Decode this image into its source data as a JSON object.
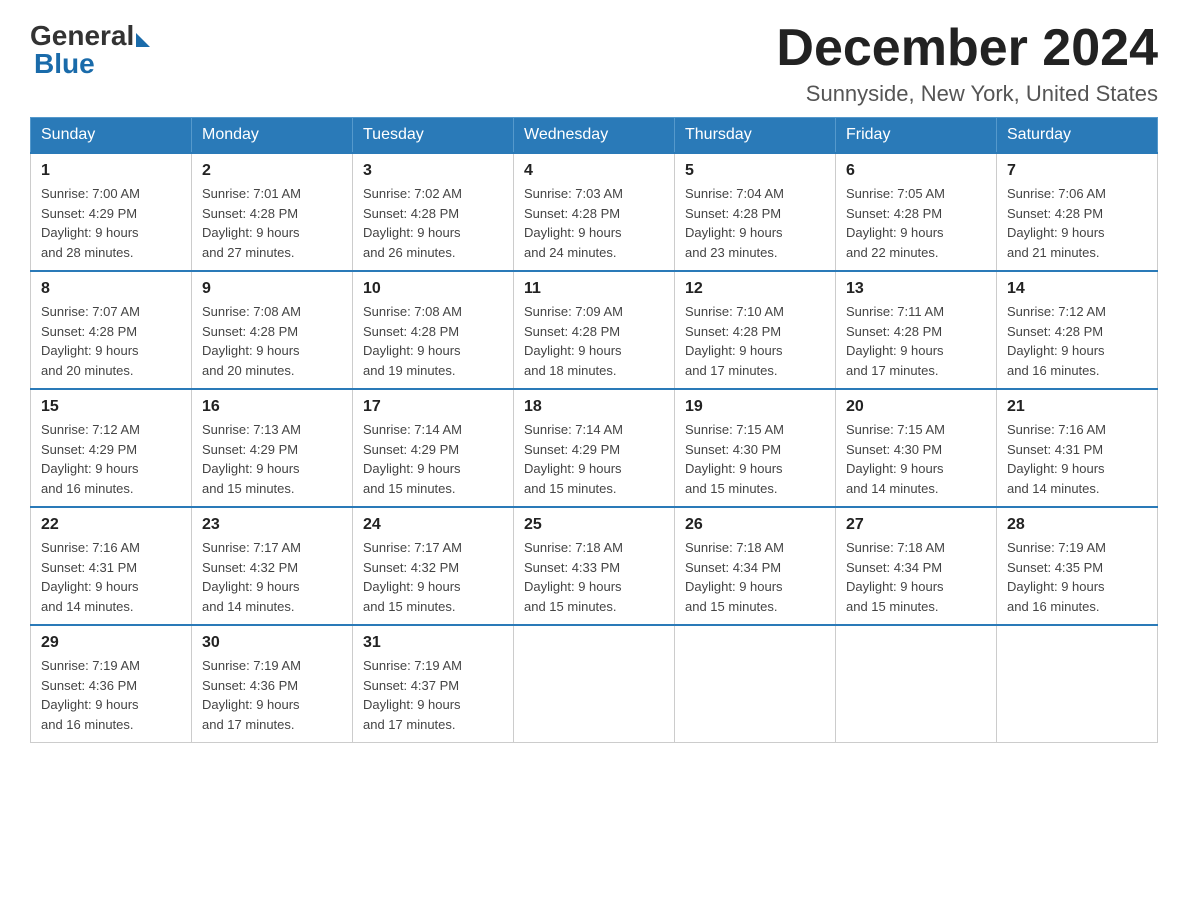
{
  "header": {
    "logo_general": "General",
    "logo_blue": "Blue",
    "month_title": "December 2024",
    "location": "Sunnyside, New York, United States"
  },
  "days_of_week": [
    "Sunday",
    "Monday",
    "Tuesday",
    "Wednesday",
    "Thursday",
    "Friday",
    "Saturday"
  ],
  "weeks": [
    [
      {
        "day": "1",
        "sunrise": "7:00 AM",
        "sunset": "4:29 PM",
        "daylight": "9 hours and 28 minutes."
      },
      {
        "day": "2",
        "sunrise": "7:01 AM",
        "sunset": "4:28 PM",
        "daylight": "9 hours and 27 minutes."
      },
      {
        "day": "3",
        "sunrise": "7:02 AM",
        "sunset": "4:28 PM",
        "daylight": "9 hours and 26 minutes."
      },
      {
        "day": "4",
        "sunrise": "7:03 AM",
        "sunset": "4:28 PM",
        "daylight": "9 hours and 24 minutes."
      },
      {
        "day": "5",
        "sunrise": "7:04 AM",
        "sunset": "4:28 PM",
        "daylight": "9 hours and 23 minutes."
      },
      {
        "day": "6",
        "sunrise": "7:05 AM",
        "sunset": "4:28 PM",
        "daylight": "9 hours and 22 minutes."
      },
      {
        "day": "7",
        "sunrise": "7:06 AM",
        "sunset": "4:28 PM",
        "daylight": "9 hours and 21 minutes."
      }
    ],
    [
      {
        "day": "8",
        "sunrise": "7:07 AM",
        "sunset": "4:28 PM",
        "daylight": "9 hours and 20 minutes."
      },
      {
        "day": "9",
        "sunrise": "7:08 AM",
        "sunset": "4:28 PM",
        "daylight": "9 hours and 20 minutes."
      },
      {
        "day": "10",
        "sunrise": "7:08 AM",
        "sunset": "4:28 PM",
        "daylight": "9 hours and 19 minutes."
      },
      {
        "day": "11",
        "sunrise": "7:09 AM",
        "sunset": "4:28 PM",
        "daylight": "9 hours and 18 minutes."
      },
      {
        "day": "12",
        "sunrise": "7:10 AM",
        "sunset": "4:28 PM",
        "daylight": "9 hours and 17 minutes."
      },
      {
        "day": "13",
        "sunrise": "7:11 AM",
        "sunset": "4:28 PM",
        "daylight": "9 hours and 17 minutes."
      },
      {
        "day": "14",
        "sunrise": "7:12 AM",
        "sunset": "4:28 PM",
        "daylight": "9 hours and 16 minutes."
      }
    ],
    [
      {
        "day": "15",
        "sunrise": "7:12 AM",
        "sunset": "4:29 PM",
        "daylight": "9 hours and 16 minutes."
      },
      {
        "day": "16",
        "sunrise": "7:13 AM",
        "sunset": "4:29 PM",
        "daylight": "9 hours and 15 minutes."
      },
      {
        "day": "17",
        "sunrise": "7:14 AM",
        "sunset": "4:29 PM",
        "daylight": "9 hours and 15 minutes."
      },
      {
        "day": "18",
        "sunrise": "7:14 AM",
        "sunset": "4:29 PM",
        "daylight": "9 hours and 15 minutes."
      },
      {
        "day": "19",
        "sunrise": "7:15 AM",
        "sunset": "4:30 PM",
        "daylight": "9 hours and 15 minutes."
      },
      {
        "day": "20",
        "sunrise": "7:15 AM",
        "sunset": "4:30 PM",
        "daylight": "9 hours and 14 minutes."
      },
      {
        "day": "21",
        "sunrise": "7:16 AM",
        "sunset": "4:31 PM",
        "daylight": "9 hours and 14 minutes."
      }
    ],
    [
      {
        "day": "22",
        "sunrise": "7:16 AM",
        "sunset": "4:31 PM",
        "daylight": "9 hours and 14 minutes."
      },
      {
        "day": "23",
        "sunrise": "7:17 AM",
        "sunset": "4:32 PM",
        "daylight": "9 hours and 14 minutes."
      },
      {
        "day": "24",
        "sunrise": "7:17 AM",
        "sunset": "4:32 PM",
        "daylight": "9 hours and 15 minutes."
      },
      {
        "day": "25",
        "sunrise": "7:18 AM",
        "sunset": "4:33 PM",
        "daylight": "9 hours and 15 minutes."
      },
      {
        "day": "26",
        "sunrise": "7:18 AM",
        "sunset": "4:34 PM",
        "daylight": "9 hours and 15 minutes."
      },
      {
        "day": "27",
        "sunrise": "7:18 AM",
        "sunset": "4:34 PM",
        "daylight": "9 hours and 15 minutes."
      },
      {
        "day": "28",
        "sunrise": "7:19 AM",
        "sunset": "4:35 PM",
        "daylight": "9 hours and 16 minutes."
      }
    ],
    [
      {
        "day": "29",
        "sunrise": "7:19 AM",
        "sunset": "4:36 PM",
        "daylight": "9 hours and 16 minutes."
      },
      {
        "day": "30",
        "sunrise": "7:19 AM",
        "sunset": "4:36 PM",
        "daylight": "9 hours and 17 minutes."
      },
      {
        "day": "31",
        "sunrise": "7:19 AM",
        "sunset": "4:37 PM",
        "daylight": "9 hours and 17 minutes."
      },
      null,
      null,
      null,
      null
    ]
  ],
  "labels": {
    "sunrise": "Sunrise:",
    "sunset": "Sunset:",
    "daylight": "Daylight:"
  }
}
